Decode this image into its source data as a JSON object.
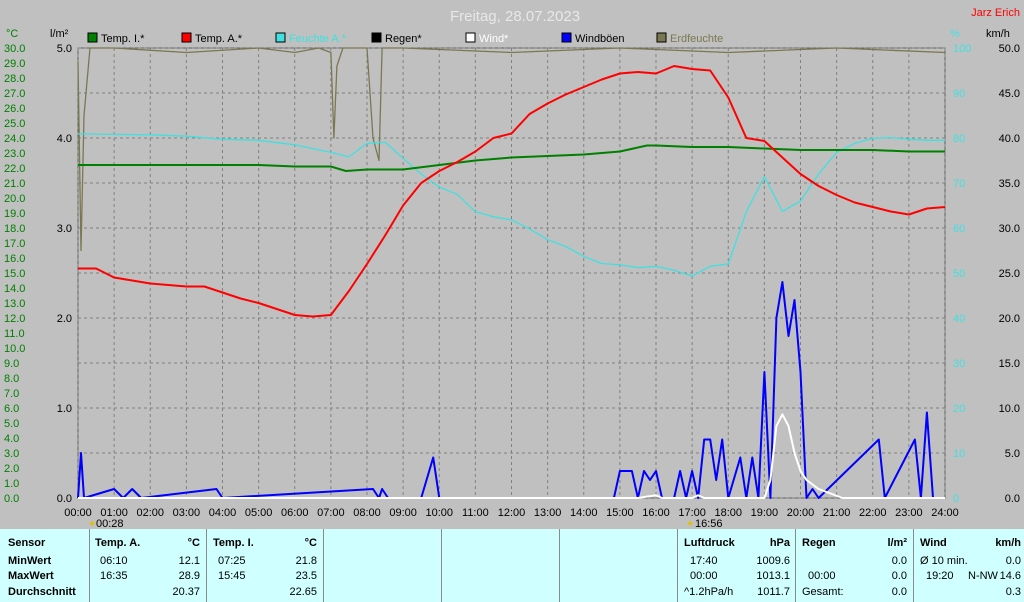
{
  "title": "Freitag, 28.07.2023",
  "site": "Jarz Erich",
  "axis_labels": {
    "temp_unit": "°C",
    "rain_unit": "l/m²",
    "humidity_unit": "%",
    "wind_unit": "km/h"
  },
  "ticks": {
    "temp": [
      "30.0",
      "29.0",
      "28.0",
      "27.0",
      "26.0",
      "25.0",
      "24.0",
      "23.0",
      "22.0",
      "21.0",
      "20.0",
      "19.0",
      "18.0",
      "17.0",
      "16.0",
      "15.0",
      "14.0",
      "13.0",
      "12.0",
      "11.0",
      "10.0",
      "9.0",
      "8.0",
      "7.0",
      "6.0",
      "5.0",
      "4.0",
      "3.0",
      "2.0",
      "1.0",
      "0.0"
    ],
    "rain": [
      "5.0",
      "4.0",
      "3.0",
      "2.0",
      "1.0",
      "0.0"
    ],
    "humidity": [
      "100",
      "90",
      "80",
      "70",
      "60",
      "50",
      "40",
      "30",
      "20",
      "10",
      "0"
    ],
    "wind": [
      "50.0",
      "45.0",
      "40.0",
      "35.0",
      "30.0",
      "25.0",
      "20.0",
      "15.0",
      "10.0",
      "5.0",
      "0.0"
    ],
    "time": [
      "00:00",
      "01:00",
      "02:00",
      "03:00",
      "04:00",
      "05:00",
      "06:00",
      "07:00",
      "08:00",
      "09:00",
      "10:00",
      "11:00",
      "12:00",
      "13:00",
      "14:00",
      "15:00",
      "16:00",
      "17:00",
      "18:00",
      "19:00",
      "20:00",
      "21:00",
      "22:00",
      "23:00",
      "24:00"
    ]
  },
  "markers": {
    "sunrise": "00:28",
    "sunset": "16:56"
  },
  "legend": [
    {
      "label": "Temp. I.*",
      "color": "#008000"
    },
    {
      "label": "Temp. A.*",
      "color": "#ff0000"
    },
    {
      "label": "Feuchte A.*",
      "color": "#40e0e0"
    },
    {
      "label": "Regen*",
      "color": "#000000"
    },
    {
      "label": "Wind*",
      "color": "#ffffff"
    },
    {
      "label": "Windböen",
      "color": "#0000ff"
    },
    {
      "label": "Erdfeuchte",
      "color": "#7a7850"
    }
  ],
  "colors": {
    "plot_bg": "#c0c0c0",
    "grid": "#808080",
    "temp_axis": "#008000",
    "humidity_axis": "#40e0e0",
    "title": "#e8e8e8",
    "site": "#ff0000"
  },
  "chart_data": {
    "type": "line",
    "title": "Freitag, 28.07.2023",
    "xlim": [
      "00:00",
      "24:00"
    ],
    "ylim_temp": [
      0,
      30
    ],
    "ylim_rain": [
      0,
      5
    ],
    "ylim_humidity": [
      0,
      100
    ],
    "ylim_wind": [
      0,
      50
    ],
    "grid": true,
    "legend_position": "top",
    "series": [
      {
        "name": "Temp. A.*",
        "axis": "temp",
        "color": "#ff0000",
        "points": [
          [
            "00:00",
            15.3
          ],
          [
            "00:30",
            15.3
          ],
          [
            "01:00",
            14.7
          ],
          [
            "01:30",
            14.5
          ],
          [
            "02:00",
            14.3
          ],
          [
            "02:30",
            14.2
          ],
          [
            "03:00",
            14.1
          ],
          [
            "03:30",
            14.1
          ],
          [
            "04:00",
            13.7
          ],
          [
            "04:30",
            13.3
          ],
          [
            "05:00",
            13.0
          ],
          [
            "05:30",
            12.6
          ],
          [
            "06:00",
            12.2
          ],
          [
            "06:30",
            12.1
          ],
          [
            "07:00",
            12.2
          ],
          [
            "07:30",
            13.8
          ],
          [
            "08:00",
            15.6
          ],
          [
            "08:30",
            17.5
          ],
          [
            "09:00",
            19.5
          ],
          [
            "09:30",
            21.0
          ],
          [
            "10:00",
            21.8
          ],
          [
            "10:30",
            22.4
          ],
          [
            "11:00",
            23.1
          ],
          [
            "11:30",
            24.0
          ],
          [
            "12:00",
            24.3
          ],
          [
            "12:30",
            25.6
          ],
          [
            "13:00",
            26.3
          ],
          [
            "13:30",
            26.9
          ],
          [
            "14:00",
            27.4
          ],
          [
            "14:30",
            27.9
          ],
          [
            "15:00",
            28.3
          ],
          [
            "15:30",
            28.4
          ],
          [
            "16:00",
            28.3
          ],
          [
            "16:30",
            28.8
          ],
          [
            "17:00",
            28.6
          ],
          [
            "17:30",
            28.5
          ],
          [
            "18:00",
            26.7
          ],
          [
            "18:30",
            24.0
          ],
          [
            "19:00",
            23.8
          ],
          [
            "19:30",
            22.7
          ],
          [
            "20:00",
            21.6
          ],
          [
            "20:30",
            20.8
          ],
          [
            "21:00",
            20.2
          ],
          [
            "21:30",
            19.7
          ],
          [
            "22:00",
            19.4
          ],
          [
            "22:30",
            19.1
          ],
          [
            "23:00",
            18.9
          ],
          [
            "23:30",
            19.3
          ],
          [
            "24:00",
            19.4
          ]
        ]
      },
      {
        "name": "Temp. I.*",
        "axis": "temp",
        "color": "#008000",
        "points": [
          [
            "00:00",
            22.2
          ],
          [
            "01:00",
            22.2
          ],
          [
            "02:00",
            22.2
          ],
          [
            "03:00",
            22.2
          ],
          [
            "04:00",
            22.2
          ],
          [
            "05:00",
            22.2
          ],
          [
            "06:00",
            22.1
          ],
          [
            "07:00",
            22.1
          ],
          [
            "07:25",
            21.8
          ],
          [
            "08:00",
            21.9
          ],
          [
            "09:00",
            21.9
          ],
          [
            "10:00",
            22.2
          ],
          [
            "11:00",
            22.5
          ],
          [
            "12:00",
            22.7
          ],
          [
            "13:00",
            22.8
          ],
          [
            "14:00",
            22.9
          ],
          [
            "15:00",
            23.1
          ],
          [
            "15:45",
            23.5
          ],
          [
            "16:00",
            23.5
          ],
          [
            "17:00",
            23.4
          ],
          [
            "18:00",
            23.4
          ],
          [
            "19:00",
            23.3
          ],
          [
            "20:00",
            23.2
          ],
          [
            "21:00",
            23.2
          ],
          [
            "22:00",
            23.2
          ],
          [
            "23:00",
            23.1
          ],
          [
            "24:00",
            23.1
          ]
        ]
      },
      {
        "name": "Feuchte A.*",
        "axis": "humidity",
        "color": "#40e0e0",
        "points": [
          [
            "00:00",
            80.9
          ],
          [
            "01:00",
            80.8
          ],
          [
            "02:00",
            80.7
          ],
          [
            "03:00",
            80.4
          ],
          [
            "04:00",
            79.7
          ],
          [
            "05:00",
            79.5
          ],
          [
            "06:00",
            78.5
          ],
          [
            "07:00",
            76.8
          ],
          [
            "07:30",
            75.8
          ],
          [
            "08:00",
            78.8
          ],
          [
            "08:30",
            79.1
          ],
          [
            "09:00",
            75.5
          ],
          [
            "09:30",
            72.0
          ],
          [
            "10:00",
            69.1
          ],
          [
            "10:30",
            67.5
          ],
          [
            "11:00",
            63.6
          ],
          [
            "11:30",
            62.5
          ],
          [
            "12:00",
            61.8
          ],
          [
            "12:30",
            59.8
          ],
          [
            "13:00",
            57.4
          ],
          [
            "13:30",
            55.9
          ],
          [
            "14:00",
            53.7
          ],
          [
            "14:30",
            52.1
          ],
          [
            "15:00",
            51.8
          ],
          [
            "15:30",
            51.2
          ],
          [
            "16:00",
            51.5
          ],
          [
            "16:30",
            50.6
          ],
          [
            "17:00",
            49.3
          ],
          [
            "17:30",
            51.5
          ],
          [
            "18:00",
            52.0
          ],
          [
            "18:30",
            63.6
          ],
          [
            "19:00",
            71.4
          ],
          [
            "19:30",
            63.7
          ],
          [
            "20:00",
            66.0
          ],
          [
            "20:30",
            72.0
          ],
          [
            "21:00",
            76.8
          ],
          [
            "21:30",
            78.8
          ],
          [
            "22:00",
            79.9
          ],
          [
            "22:30",
            80.1
          ],
          [
            "23:00",
            79.7
          ],
          [
            "23:30",
            79.5
          ],
          [
            "24:00",
            79.5
          ]
        ]
      },
      {
        "name": "Windböen",
        "axis": "wind",
        "color": "#0000ff",
        "points": [
          [
            "00:00",
            0
          ],
          [
            "00:05",
            5
          ],
          [
            "00:10",
            0
          ],
          [
            "01:00",
            1
          ],
          [
            "01:15",
            0
          ],
          [
            "01:30",
            1
          ],
          [
            "01:45",
            0
          ],
          [
            "03:50",
            1
          ],
          [
            "04:00",
            0
          ],
          [
            "08:10",
            1
          ],
          [
            "08:20",
            0
          ],
          [
            "08:25",
            1
          ],
          [
            "08:35",
            0
          ],
          [
            "09:30",
            0
          ],
          [
            "09:50",
            4.5
          ],
          [
            "10:00",
            0
          ],
          [
            "14:50",
            0
          ],
          [
            "15:00",
            3
          ],
          [
            "15:20",
            3
          ],
          [
            "15:30",
            0
          ],
          [
            "15:40",
            3
          ],
          [
            "15:50",
            2
          ],
          [
            "16:00",
            3
          ],
          [
            "16:10",
            0
          ],
          [
            "16:30",
            0
          ],
          [
            "16:40",
            3
          ],
          [
            "16:50",
            0
          ],
          [
            "17:00",
            3
          ],
          [
            "17:10",
            0
          ],
          [
            "17:20",
            6.5
          ],
          [
            "17:30",
            6.5
          ],
          [
            "17:40",
            2
          ],
          [
            "17:50",
            6.5
          ],
          [
            "18:00",
            0
          ],
          [
            "18:20",
            4.5
          ],
          [
            "18:30",
            0
          ],
          [
            "18:40",
            4.5
          ],
          [
            "18:50",
            0
          ],
          [
            "19:00",
            14
          ],
          [
            "19:10",
            0
          ],
          [
            "19:20",
            20
          ],
          [
            "19:30",
            24
          ],
          [
            "19:40",
            18
          ],
          [
            "19:50",
            22
          ],
          [
            "20:00",
            14
          ],
          [
            "20:10",
            0
          ],
          [
            "20:20",
            1
          ],
          [
            "20:30",
            0
          ],
          [
            "22:10",
            6.5
          ],
          [
            "22:20",
            0
          ],
          [
            "23:10",
            6.5
          ],
          [
            "23:20",
            0
          ],
          [
            "23:30",
            9.5
          ],
          [
            "23:40",
            0
          ],
          [
            "24:00",
            0
          ]
        ]
      },
      {
        "name": "Wind*",
        "axis": "wind",
        "color": "#ffffff",
        "points": [
          [
            "00:00",
            0
          ],
          [
            "15:30",
            0
          ],
          [
            "16:00",
            0.3
          ],
          [
            "16:10",
            0
          ],
          [
            "17:00",
            0
          ],
          [
            "17:10",
            0.3
          ],
          [
            "17:20",
            0
          ],
          [
            "19:00",
            0
          ],
          [
            "19:10",
            2
          ],
          [
            "19:20",
            8
          ],
          [
            "19:30",
            9.3
          ],
          [
            "19:40",
            8
          ],
          [
            "19:50",
            5
          ],
          [
            "20:00",
            3
          ],
          [
            "20:10",
            2
          ],
          [
            "20:30",
            1
          ],
          [
            "20:50",
            0.5
          ],
          [
            "21:10",
            0
          ],
          [
            "24:00",
            0
          ]
        ]
      },
      {
        "name": "Erdfeuchte",
        "axis": "humidity",
        "color": "#7a7850",
        "points": [
          [
            "00:00",
            97
          ],
          [
            "00:05",
            55
          ],
          [
            "00:10",
            85
          ],
          [
            "00:20",
            100
          ],
          [
            "01:00",
            100
          ],
          [
            "03:00",
            99
          ],
          [
            "05:00",
            100
          ],
          [
            "06:00",
            99
          ],
          [
            "06:40",
            100
          ],
          [
            "07:00",
            99
          ],
          [
            "07:05",
            80
          ],
          [
            "07:10",
            96
          ],
          [
            "07:20",
            100
          ],
          [
            "08:00",
            100
          ],
          [
            "08:10",
            80
          ],
          [
            "08:20",
            75
          ],
          [
            "08:25",
            100
          ],
          [
            "09:00",
            100
          ],
          [
            "12:00",
            99
          ],
          [
            "15:00",
            100
          ],
          [
            "18:00",
            99
          ],
          [
            "21:00",
            100
          ],
          [
            "24:00",
            99
          ]
        ]
      }
    ]
  },
  "stats": {
    "sensor": {
      "header": "Sensor",
      "rows": [
        "MinWert",
        "MaxWert",
        "Durchschnitt"
      ]
    },
    "temp_a": {
      "header": "Temp. A.",
      "unit": "°C",
      "min_time": "06:10",
      "min": "12.1",
      "max_time": "16:35",
      "max": "28.9",
      "avg": "20.37"
    },
    "temp_i": {
      "header": "Temp. I.",
      "unit": "°C",
      "min_time": "07:25",
      "min": "21.8",
      "max_time": "15:45",
      "max": "23.5",
      "avg": "22.65"
    },
    "pressure": {
      "header": "Luftdruck",
      "unit": "hPa",
      "r1_time": "17:40",
      "r1": "1009.6",
      "r2_time": "00:00",
      "r2": "1013.1",
      "r3_label": "^1.2hPa/h",
      "r3": "1011.7"
    },
    "rain": {
      "header": "Regen",
      "unit": "l/m²",
      "r1": "0.0",
      "r2_time": "00:00",
      "r2": "0.0",
      "r3_label": "Gesamt:",
      "r3": "0.0"
    },
    "wind": {
      "header": "Wind",
      "unit": "km/h",
      "r1_label": "Ø 10 min.",
      "r1": "0.0",
      "r2_time": "19:20",
      "r2_dir": "N-NW",
      "r2": "14.6",
      "r3": "0.3"
    }
  }
}
